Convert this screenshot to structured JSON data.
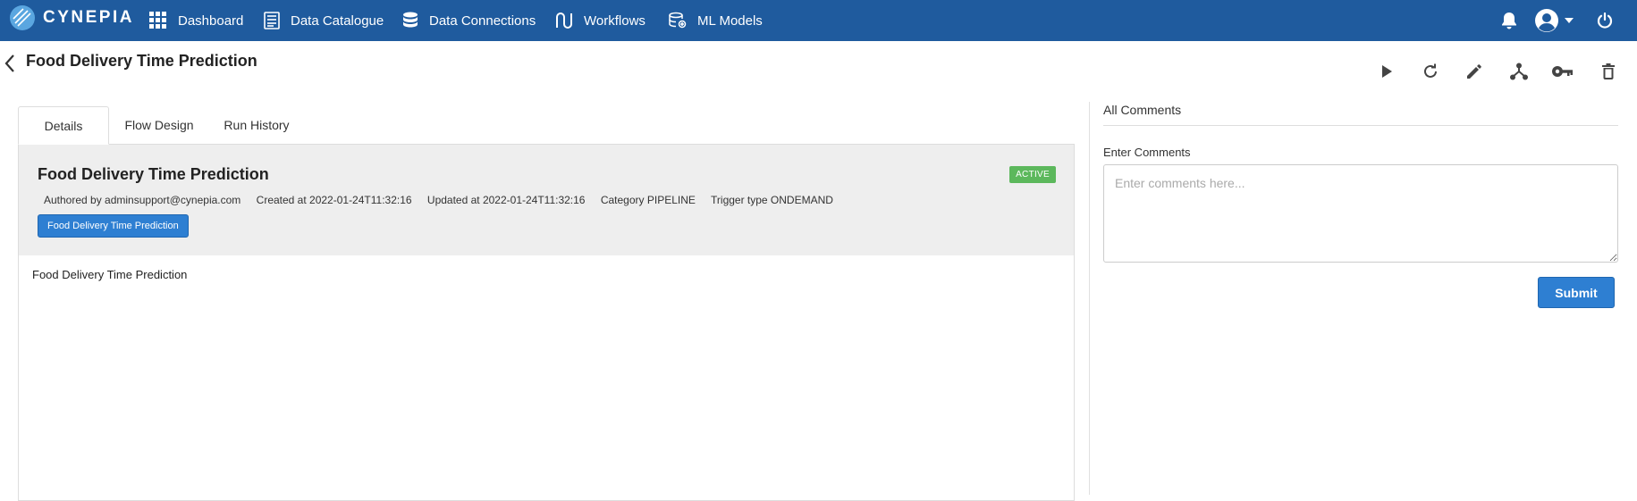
{
  "brand": {
    "name": "CYNEPIA"
  },
  "nav": {
    "items": [
      {
        "label": "Dashboard",
        "icon": "grid-icon"
      },
      {
        "label": "Data Catalogue",
        "icon": "catalogue-icon"
      },
      {
        "label": "Data Connections",
        "icon": "database-icon"
      },
      {
        "label": "Workflows",
        "icon": "workflow-icon"
      },
      {
        "label": "ML Models",
        "icon": "ml-models-icon"
      }
    ]
  },
  "page": {
    "title": "Food Delivery Time Prediction"
  },
  "toolbar": {
    "icons": [
      "play-icon",
      "refresh-icon",
      "edit-icon",
      "fork-icon",
      "key-icon",
      "delete-icon"
    ]
  },
  "tabs": [
    {
      "label": "Details",
      "active": true
    },
    {
      "label": "Flow Design",
      "active": false
    },
    {
      "label": "Run History",
      "active": false
    }
  ],
  "details": {
    "title": "Food Delivery Time Prediction",
    "status": "ACTIVE",
    "authored": "Authored by adminsupport@cynepia.com",
    "created": "Created at 2022-01-24T11:32:16",
    "updated": "Updated at 2022-01-24T11:32:16",
    "category": "Category PIPELINE",
    "trigger": "Trigger type ONDEMAND",
    "tag": "Food Delivery Time Prediction",
    "description": "Food Delivery Time Prediction"
  },
  "comments": {
    "title": "All Comments",
    "label": "Enter Comments",
    "placeholder": "Enter comments here...",
    "submit_label": "Submit"
  },
  "colors": {
    "navbar": "#1f5b9e",
    "primary_button": "#2e7fd2",
    "status_active": "#5cb85c"
  }
}
